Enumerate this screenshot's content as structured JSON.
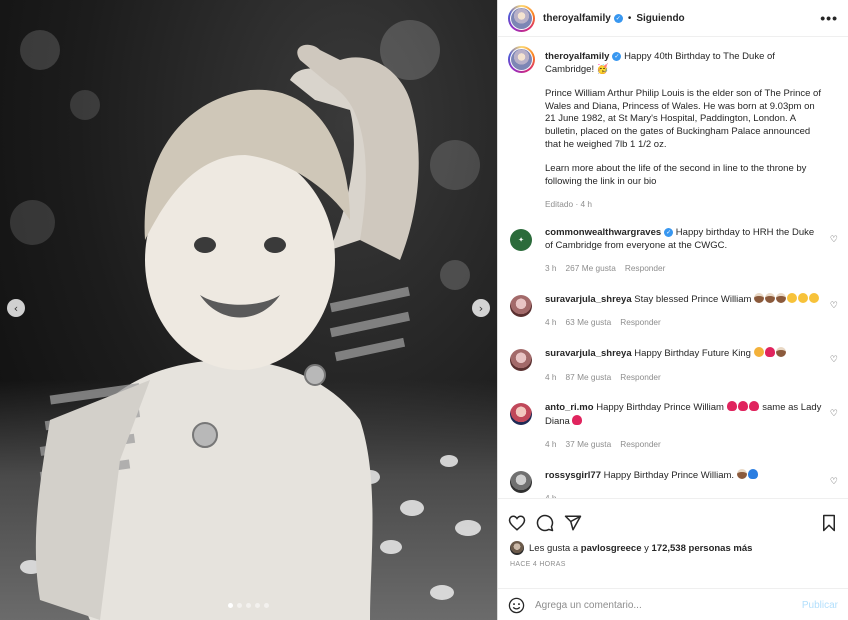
{
  "header": {
    "username": "theroyalfamily",
    "follow_status": "Siguiendo",
    "more_icon": "•••"
  },
  "caption": {
    "username": "theroyalfamily",
    "title": "Happy 40th Birthday to The Duke of Cambridge! 🥳",
    "paragraph1": "Prince William Arthur Philip Louis is the elder son of The Prince of Wales and Diana, Princess of Wales. He was born at 9.03pm on 21 June 1982, at St Mary's Hospital, Paddington, London. A bulletin, placed on the gates of Buckingham Palace announced that he weighed 7lb 1 1/2 oz.",
    "paragraph2": "Learn more about the life of the second in line to the throne by following the link in our bio",
    "meta": "Editado · 4 h"
  },
  "comments": [
    {
      "username": "commonwealthwargraves",
      "text": "Happy birthday to HRH the Duke of Cambridge from everyone at the CWGC.",
      "time": "3 h",
      "likes": "267 Me gusta",
      "reply": "Responder"
    },
    {
      "username": "suravarjula_shreya",
      "text": "Stay blessed Prince William",
      "time": "4 h",
      "likes": "63 Me gusta",
      "reply": "Responder"
    },
    {
      "username": "suravarjula_shreya",
      "text": "Happy Birthday Future King",
      "time": "4 h",
      "likes": "87 Me gusta",
      "reply": "Responder"
    },
    {
      "username": "anto_ri.mo",
      "text": "Happy Birthday Prince William",
      "text2": "same as Lady Diana",
      "time": "4 h",
      "likes": "37 Me gusta",
      "reply": "Responder"
    },
    {
      "username": "rossysgirl77",
      "text": "Happy Birthday Prince William.",
      "time": "4 h",
      "likes": "",
      "reply": ""
    }
  ],
  "likes": {
    "prefix": "Les gusta a",
    "user": "pavlosgreece",
    "middle": "y",
    "count": "172,538 personas más"
  },
  "timestamp": "HACE 4 HORAS",
  "add_comment": {
    "placeholder": "Agrega un comentario...",
    "publish": "Publicar"
  },
  "icons": {
    "prev": "‹",
    "next": "›"
  },
  "colors": {
    "verified": "#3897f0",
    "publish_disabled": "#b2dffc",
    "muted": "#8e8e8e"
  }
}
